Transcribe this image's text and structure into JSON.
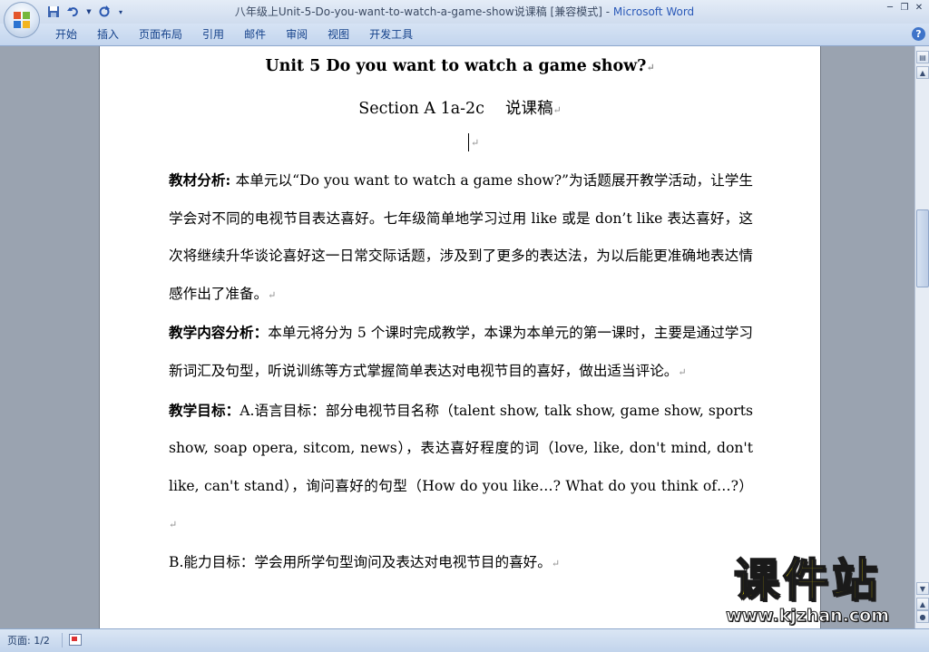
{
  "window": {
    "title": "八年级上Unit-5-Do-you-want-to-watch-a-game-show说课稿 [兼容模式] - ",
    "app_name": "Microsoft Word"
  },
  "ribbon": {
    "tabs": [
      "开始",
      "插入",
      "页面布局",
      "引用",
      "邮件",
      "审阅",
      "视图",
      "开发工具"
    ]
  },
  "document": {
    "title": "Unit 5 Do you want to watch a game show?",
    "subtitle": "Section A 1a-2c　 说课稿",
    "pilcrow": "↵",
    "paragraphs": [
      {
        "label": "教材分析",
        "sep": ": ",
        "text": "本单元以“Do you want to watch a game show?”为话题展开教学活动，让学生学会对不同的电视节目表达喜好。七年级简单地学习过用 like 或是 don’t like 表达喜好，这次将继续升华谈论喜好这一日常交际话题，涉及到了更多的表达法，为以后能更准确地表达情感作出了准备。"
      },
      {
        "label": "教学内容分析",
        "sep": "：",
        "text": "本单元将分为 5 个课时完成教学，本课为本单元的第一课时，主要是通过学习新词汇及句型，听说训练等方式掌握简单表达对电视节目的喜好，做出适当评论。"
      },
      {
        "label": "教学目标",
        "sep": "：",
        "text": "A.语言目标：部分电视节目名称（talent show, talk show, game show, sports show, soap opera, sitcom, news），表达喜好程度的词（love, like, don't mind, don't like, can't stand），询问喜好的句型（How do you like…? What do you think of…?）"
      },
      {
        "label": "",
        "sep": "",
        "text": "B.能力目标：学会用所学句型询问及表达对电视节目的喜好。"
      }
    ]
  },
  "statusbar": {
    "page_indicator": "页面: 1/2"
  },
  "watermark": {
    "title": "课件站",
    "url": "www.kjzhan.com"
  },
  "colors": {
    "accent": "#2a59b8",
    "ribbon_text": "#15428b",
    "workspace": "#9aa3b0",
    "watermark_fill": "#f3e000"
  }
}
